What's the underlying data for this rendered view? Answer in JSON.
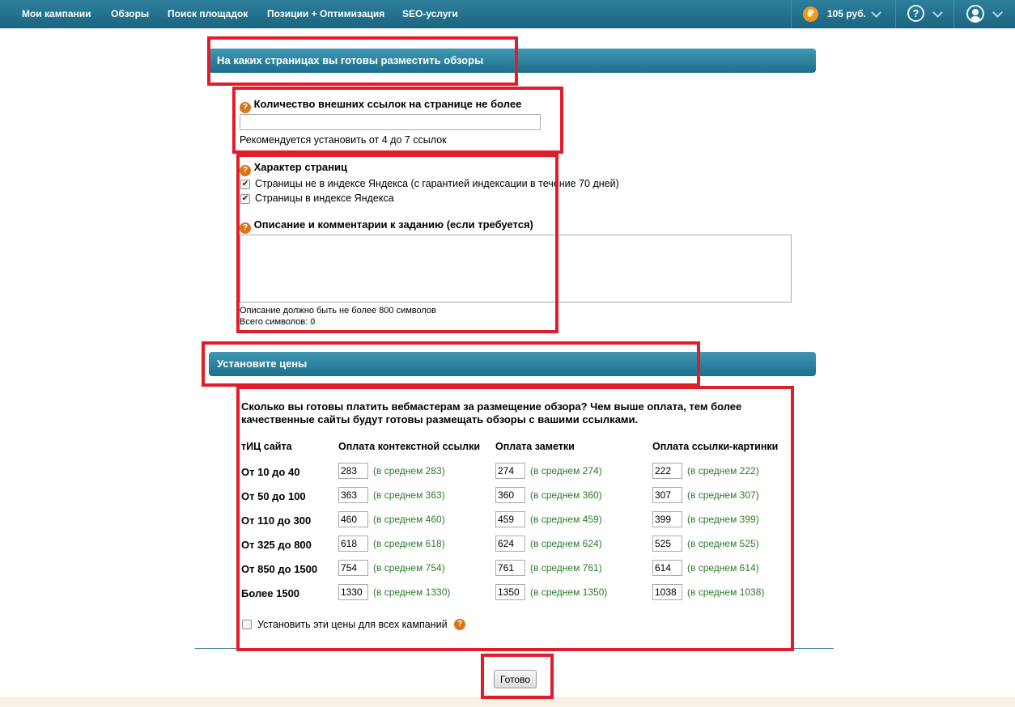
{
  "nav": {
    "items": [
      "Мои кампании",
      "Обзоры",
      "Поиск площадок",
      "Позиции + Оптимизация",
      "SEO-услуги"
    ],
    "currency_symbol": "₽",
    "balance": "105 руб.",
    "help_symbol": "?"
  },
  "section1": {
    "title": "На каких страницах вы готовы разместить обзоры",
    "links_label": "Количество внешних ссылок на странице не более",
    "links_value": "",
    "links_hint": "Рекомендуется установить от 4 до 7 ссылок",
    "page_type_label": "Характер страниц",
    "page_types": [
      {
        "label": "Страницы не в индексе Яндекса (с гарантией индексации в течение 70 дней)",
        "checked": true
      },
      {
        "label": "Страницы в индексе Яндекса",
        "checked": true
      }
    ],
    "description_label": "Описание и комментарии к заданию (если требуется)",
    "description_value": "",
    "description_limit": "Описание должно быть не более 800 символов",
    "char_count_label": "Всего символов:",
    "char_count": "0"
  },
  "section2": {
    "title": "Установите цены",
    "intro": "Сколько вы готовы платить вебмастерам за размещение обзора? Чем выше оплата, тем более качественные сайты будут готовы размещать обзоры с вашими ссылками.",
    "columns": [
      "тИЦ сайта",
      "Оплата контекстной ссылки",
      "Оплата заметки",
      "Оплата ссылки-картинки"
    ],
    "rows": [
      {
        "label": "От 10 до 40",
        "prices": [
          {
            "value": "283",
            "avg": "(в среднем 283)"
          },
          {
            "value": "274",
            "avg": "(в среднем 274)"
          },
          {
            "value": "222",
            "avg": "(в среднем 222)"
          }
        ]
      },
      {
        "label": "От 50 до 100",
        "prices": [
          {
            "value": "363",
            "avg": "(в среднем 363)"
          },
          {
            "value": "360",
            "avg": "(в среднем 360)"
          },
          {
            "value": "307",
            "avg": "(в среднем 307)"
          }
        ]
      },
      {
        "label": "От 110 до 300",
        "prices": [
          {
            "value": "460",
            "avg": "(в среднем 460)"
          },
          {
            "value": "459",
            "avg": "(в среднем 459)"
          },
          {
            "value": "399",
            "avg": "(в среднем 399)"
          }
        ]
      },
      {
        "label": "От 325 до 800",
        "prices": [
          {
            "value": "618",
            "avg": "(в среднем 618)"
          },
          {
            "value": "624",
            "avg": "(в среднем 624)"
          },
          {
            "value": "525",
            "avg": "(в среднем 525)"
          }
        ]
      },
      {
        "label": "От 850 до 1500",
        "prices": [
          {
            "value": "754",
            "avg": "(в среднем 754)"
          },
          {
            "value": "761",
            "avg": "(в среднем 761)"
          },
          {
            "value": "614",
            "avg": "(в среднем 614)"
          }
        ]
      },
      {
        "label": "Более 1500",
        "prices": [
          {
            "value": "1330",
            "avg": "(в среднем 1330)"
          },
          {
            "value": "1350",
            "avg": "(в среднем 1350)"
          },
          {
            "value": "1038",
            "avg": "(в среднем 1038)"
          }
        ]
      }
    ],
    "apply_all_label": "Установить эти цены для всех кампаний",
    "apply_all_checked": false
  },
  "actions": {
    "submit_label": "Готово"
  },
  "colors": {
    "header": "#1d6f8c",
    "highlight": "#e11d2c",
    "avg_text": "#2a7a2a",
    "coin": "#f29a18"
  }
}
